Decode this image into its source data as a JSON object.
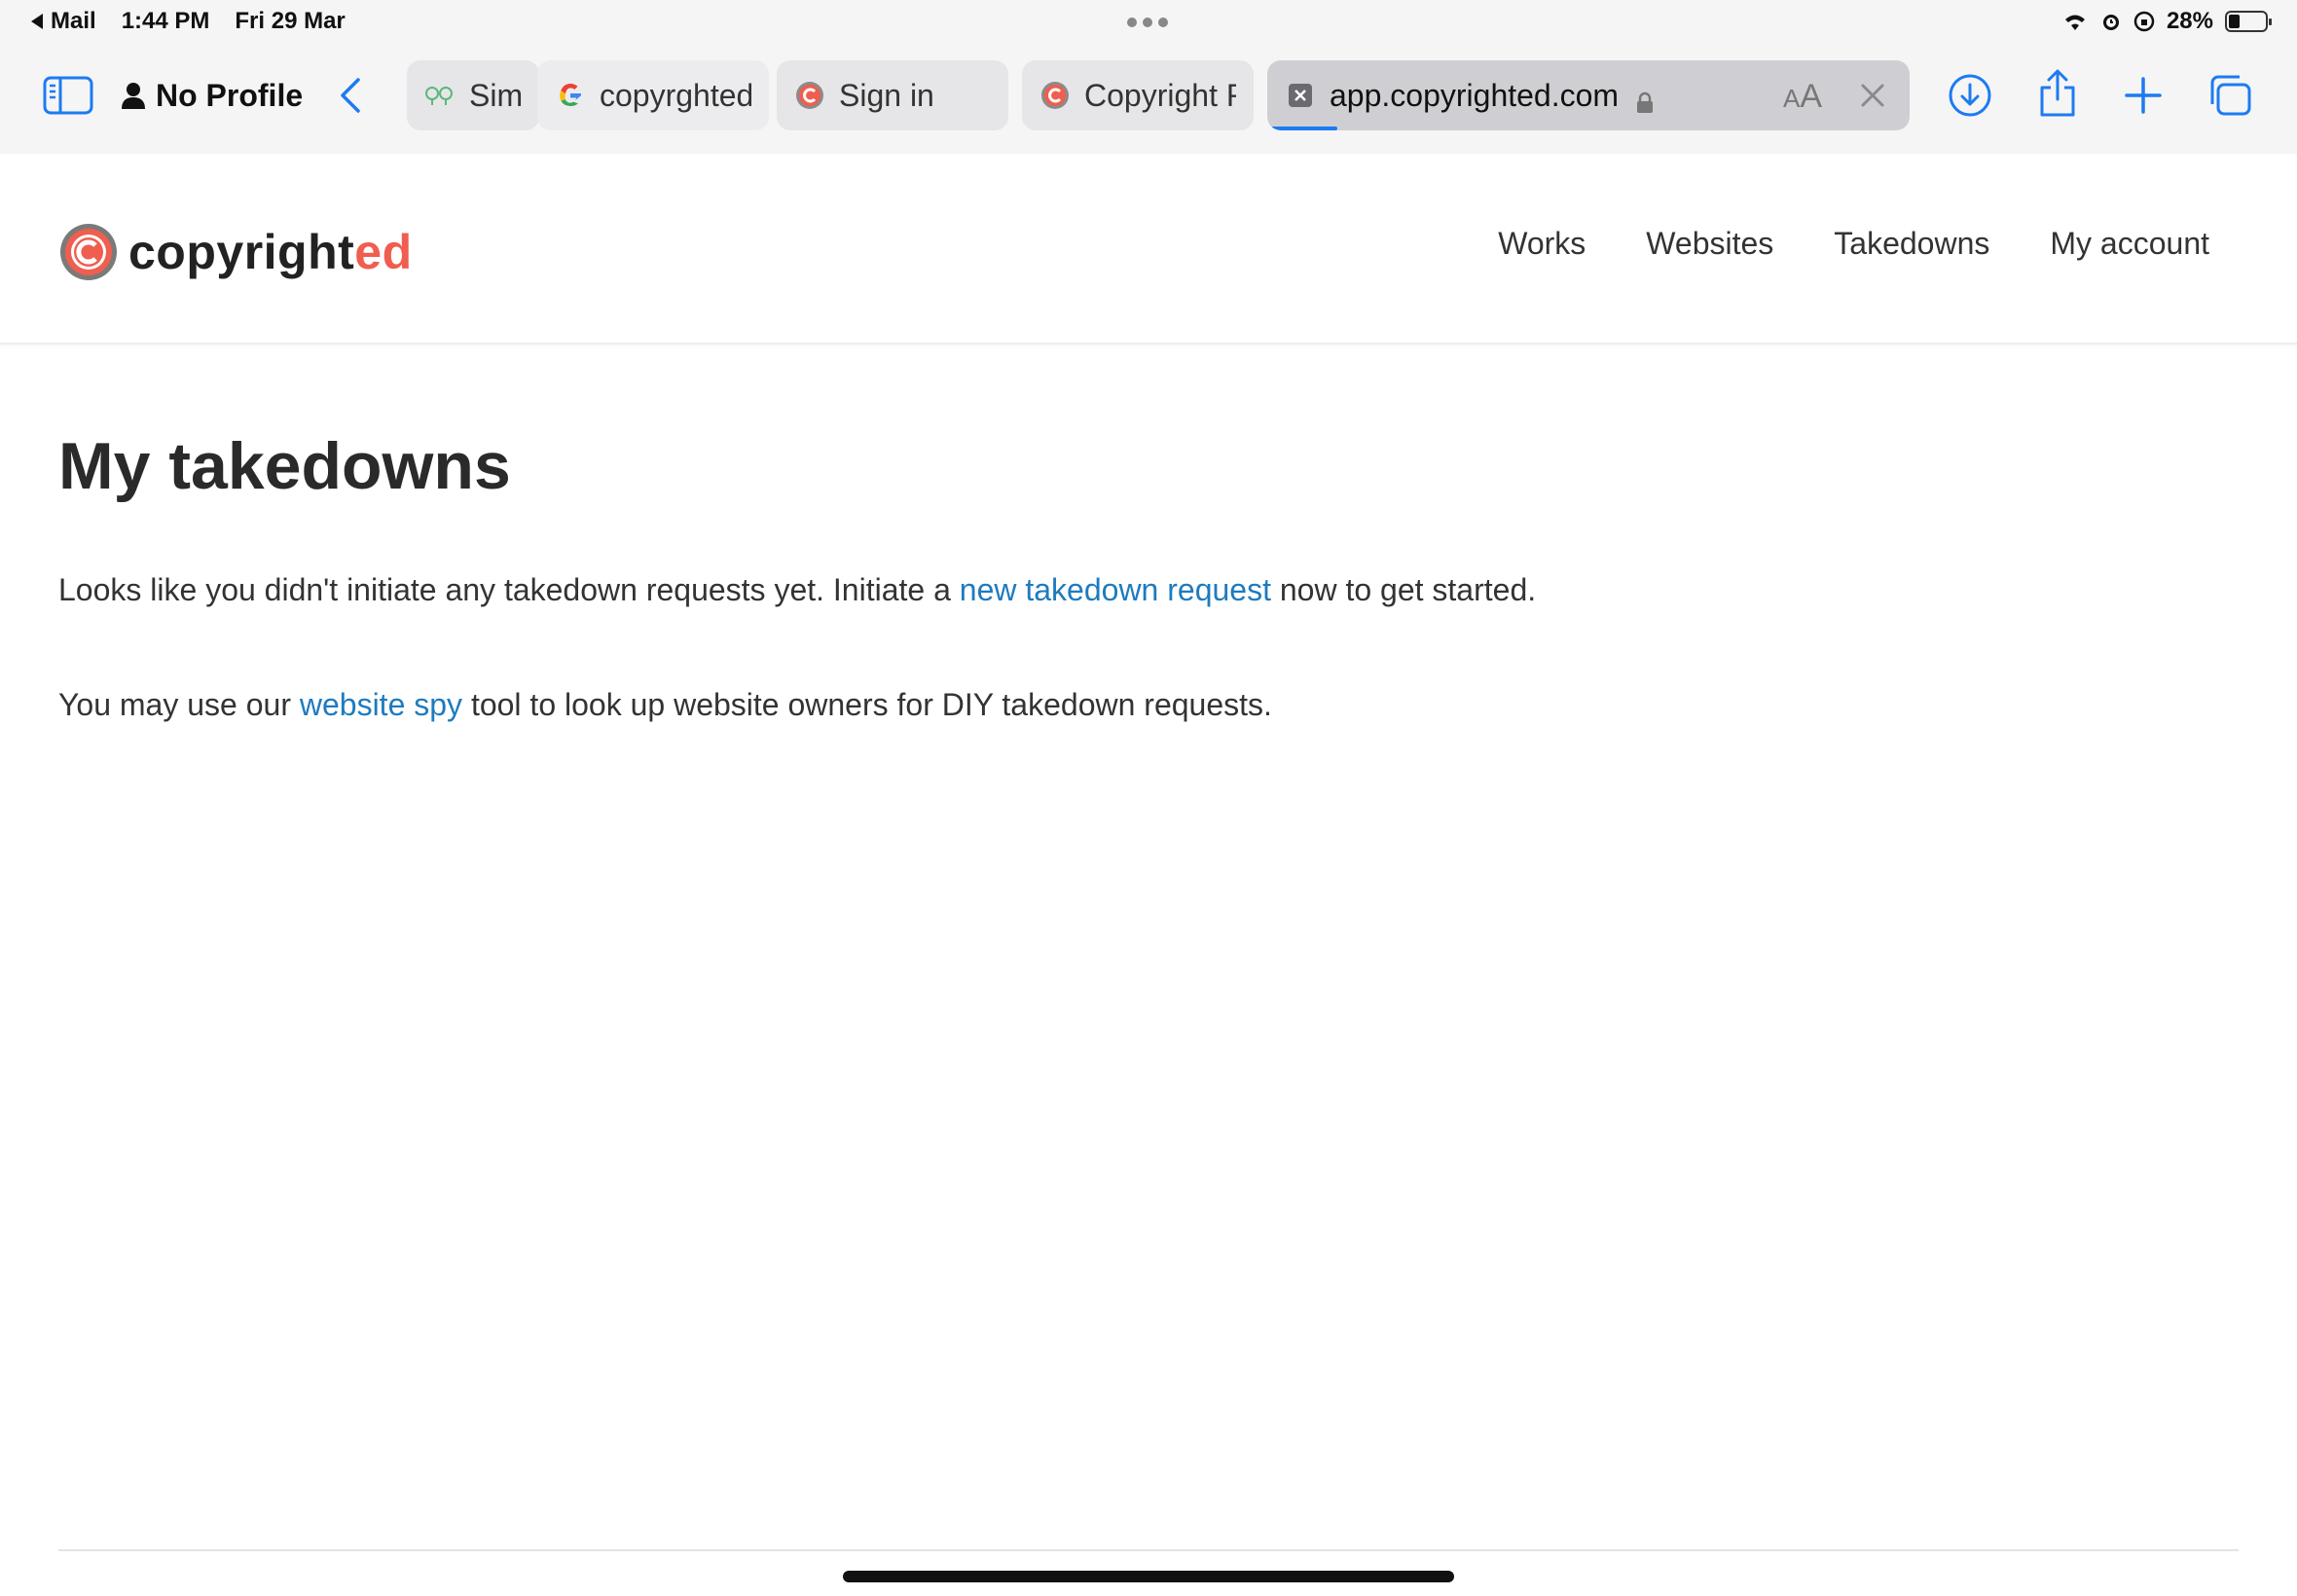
{
  "status_bar": {
    "back_app": "Mail",
    "time": "1:44 PM",
    "date": "Fri 29 Mar",
    "battery": "28%",
    "battery_level": 0.28
  },
  "browser": {
    "profile_label": "No Profile",
    "tabs": [
      {
        "label": "Simp",
        "icon": "grid-favicon"
      },
      {
        "label": "copyrghted",
        "icon": "google-favicon"
      },
      {
        "label": "Sign in",
        "icon": "copyrighted-favicon"
      },
      {
        "label": "Copyright R",
        "icon": "copyrighted-favicon"
      }
    ],
    "active_tab": {
      "url": "app.copyrighted.com",
      "icon": "close-square-favicon",
      "reader_label": "A"
    },
    "accent_color": "#1d7bf0"
  },
  "site": {
    "logo_main": "copyright",
    "logo_accent": "ed",
    "brand_color": "#ef5e4e",
    "nav": [
      "Works",
      "Websites",
      "Takedowns",
      "My account"
    ]
  },
  "content": {
    "title": "My takedowns",
    "para1_before": "Looks like you didn't initiate any takedown requests yet. Initiate a ",
    "para1_link": "new takedown request",
    "para1_after": " now to get started.",
    "para2_before": "You may use our ",
    "para2_link": "website spy",
    "para2_after": " tool to look up website owners for DIY takedown requests.",
    "link_color": "#1e7bbf"
  }
}
